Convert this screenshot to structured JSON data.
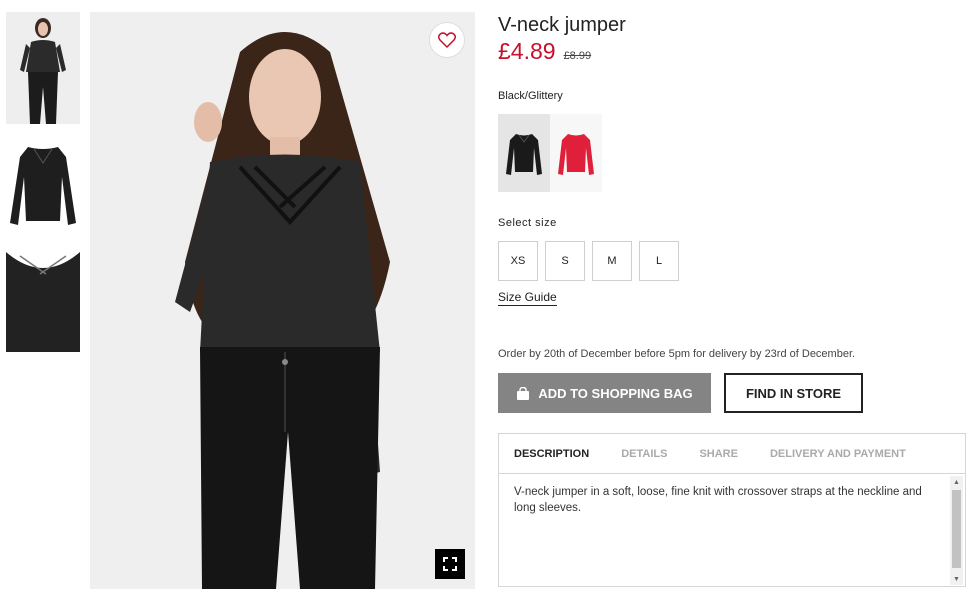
{
  "product": {
    "title": "V-neck jumper",
    "price": "£4.89",
    "old_price": "£8.99",
    "color_name": "Black/Glittery"
  },
  "gallery": {
    "thumbnails": [
      "model-front",
      "garment-flat",
      "garment-detail"
    ],
    "favourite_icon": "heart-icon",
    "zoom_icon": "fullscreen-icon"
  },
  "colors": [
    {
      "name": "black-swatch",
      "hex": "#1a1a1a",
      "selected": true
    },
    {
      "name": "red-swatch",
      "hex": "#e0203a",
      "selected": false
    }
  ],
  "sizes": {
    "label": "Select size",
    "options": [
      "XS",
      "S",
      "M",
      "L"
    ],
    "guide_label": "Size Guide"
  },
  "delivery_note": "Order by 20th of December before 5pm for delivery by 23rd of December.",
  "actions": {
    "add_to_bag": "ADD TO SHOPPING BAG",
    "find_in_store": "FIND IN STORE",
    "bag_icon": "shopping-bag-icon"
  },
  "tabs": {
    "items": [
      "DESCRIPTION",
      "DETAILS",
      "SHARE",
      "DELIVERY AND PAYMENT"
    ],
    "active": "DESCRIPTION",
    "description": "V-neck jumper in a soft, loose, fine knit with crossover straps at the neckline and long sleeves."
  },
  "theme": {
    "price_color": "#c8102e",
    "button_grey": "#848484"
  }
}
